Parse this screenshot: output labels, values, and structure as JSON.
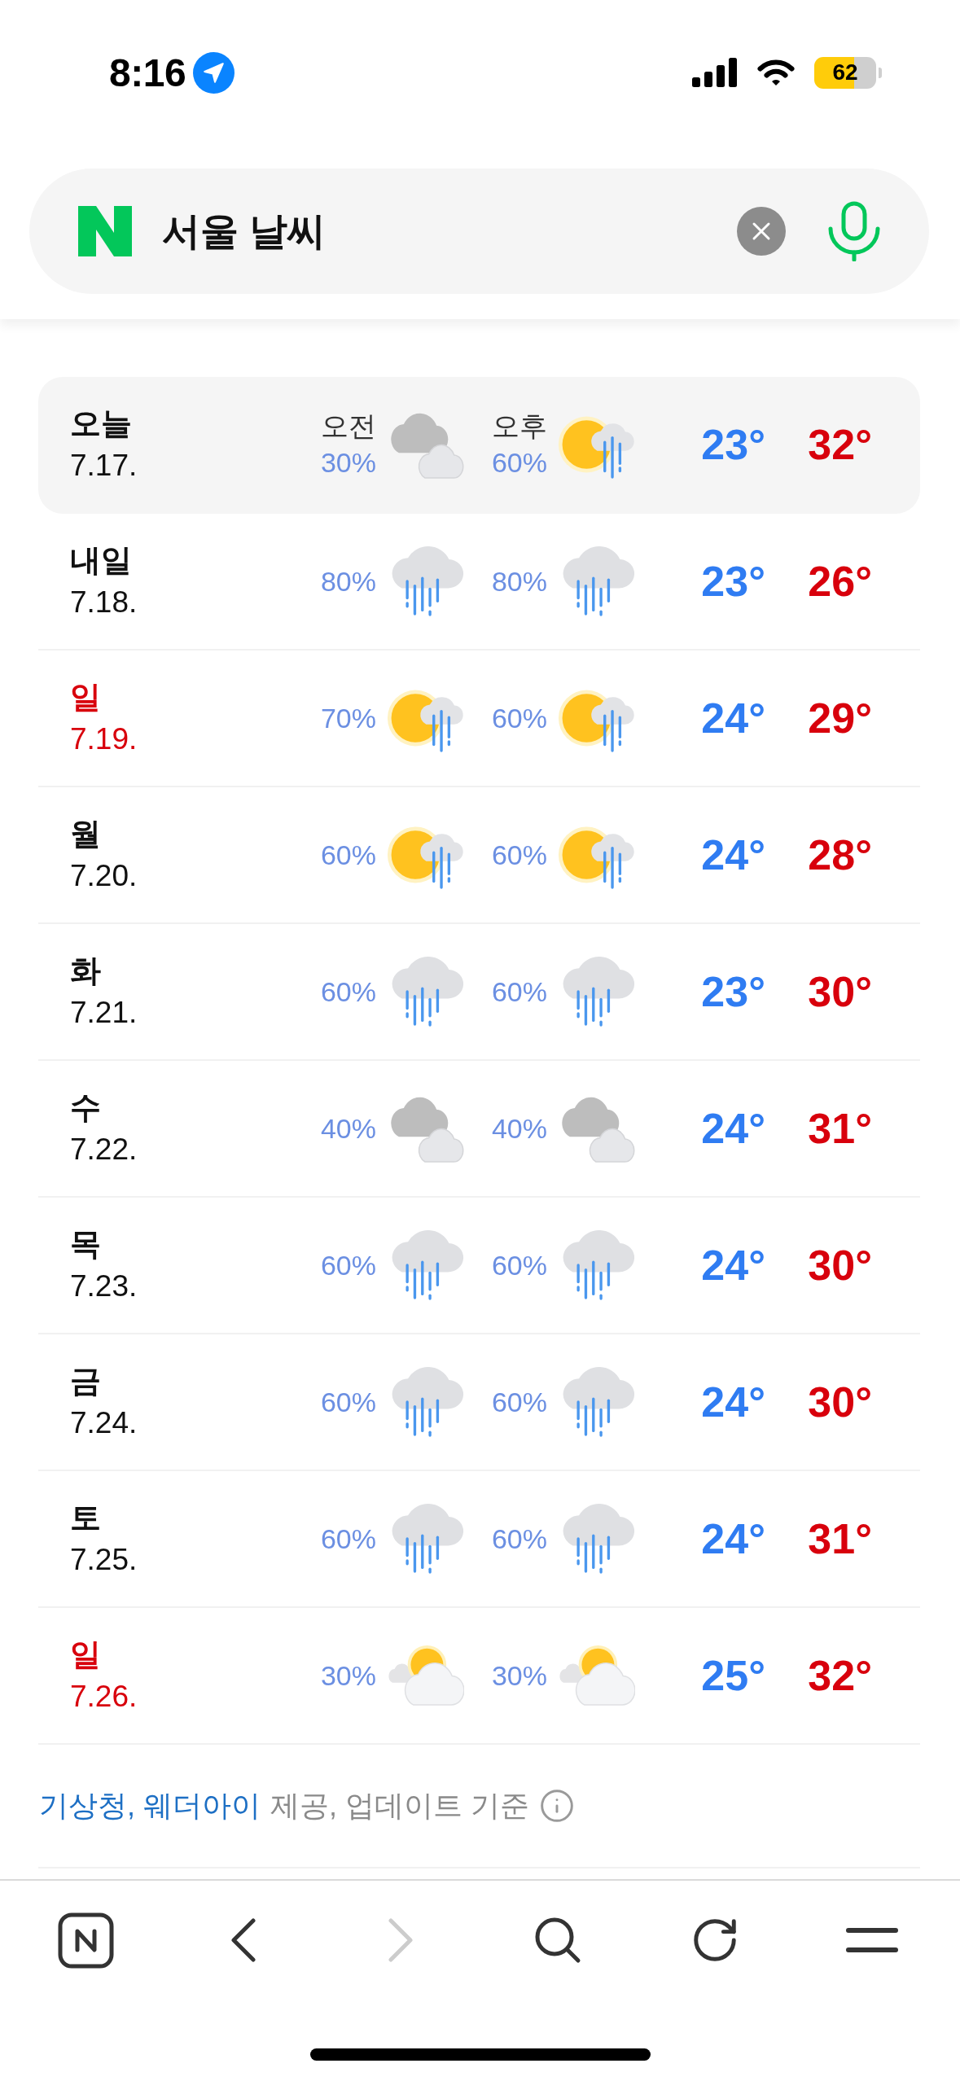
{
  "status_bar": {
    "time": "8:16",
    "battery": "62"
  },
  "search": {
    "value": "서울 날씨"
  },
  "forecast": {
    "days": [
      {
        "day": "오늘",
        "date": "7.17.",
        "holiday": false,
        "selected": true,
        "am": {
          "label": "오전",
          "chance": "30%",
          "kind": "clouds"
        },
        "pm": {
          "label": "오후",
          "chance": "60%",
          "kind": "sun-rain"
        },
        "low": "23°",
        "high": "32°"
      },
      {
        "day": "내일",
        "date": "7.18.",
        "holiday": false,
        "selected": false,
        "am": {
          "chance": "80%",
          "kind": "rain"
        },
        "pm": {
          "chance": "80%",
          "kind": "rain"
        },
        "low": "23°",
        "high": "26°"
      },
      {
        "day": "일",
        "date": "7.19.",
        "holiday": true,
        "selected": false,
        "am": {
          "chance": "70%",
          "kind": "sun-rain"
        },
        "pm": {
          "chance": "60%",
          "kind": "sun-rain"
        },
        "low": "24°",
        "high": "29°"
      },
      {
        "day": "월",
        "date": "7.20.",
        "holiday": false,
        "selected": false,
        "am": {
          "chance": "60%",
          "kind": "sun-rain"
        },
        "pm": {
          "chance": "60%",
          "kind": "sun-rain"
        },
        "low": "24°",
        "high": "28°"
      },
      {
        "day": "화",
        "date": "7.21.",
        "holiday": false,
        "selected": false,
        "am": {
          "chance": "60%",
          "kind": "rain"
        },
        "pm": {
          "chance": "60%",
          "kind": "rain"
        },
        "low": "23°",
        "high": "30°"
      },
      {
        "day": "수",
        "date": "7.22.",
        "holiday": false,
        "selected": false,
        "am": {
          "chance": "40%",
          "kind": "clouds"
        },
        "pm": {
          "chance": "40%",
          "kind": "clouds"
        },
        "low": "24°",
        "high": "31°"
      },
      {
        "day": "목",
        "date": "7.23.",
        "holiday": false,
        "selected": false,
        "am": {
          "chance": "60%",
          "kind": "rain"
        },
        "pm": {
          "chance": "60%",
          "kind": "rain"
        },
        "low": "24°",
        "high": "30°"
      },
      {
        "day": "금",
        "date": "7.24.",
        "holiday": false,
        "selected": false,
        "am": {
          "chance": "60%",
          "kind": "rain"
        },
        "pm": {
          "chance": "60%",
          "kind": "rain"
        },
        "low": "24°",
        "high": "30°"
      },
      {
        "day": "토",
        "date": "7.25.",
        "holiday": false,
        "selected": false,
        "am": {
          "chance": "60%",
          "kind": "rain"
        },
        "pm": {
          "chance": "60%",
          "kind": "rain"
        },
        "low": "24°",
        "high": "31°"
      },
      {
        "day": "일",
        "date": "7.26.",
        "holiday": true,
        "selected": false,
        "am": {
          "chance": "30%",
          "kind": "sun-cloud"
        },
        "pm": {
          "chance": "30%",
          "kind": "sun-cloud"
        },
        "low": "25°",
        "high": "32°"
      }
    ]
  },
  "source": {
    "providers": "기상청, 웨더아이",
    "note": "제공, 업데이트 기준"
  },
  "toolbar": {
    "back_disabled": false,
    "forward_disabled": true
  }
}
